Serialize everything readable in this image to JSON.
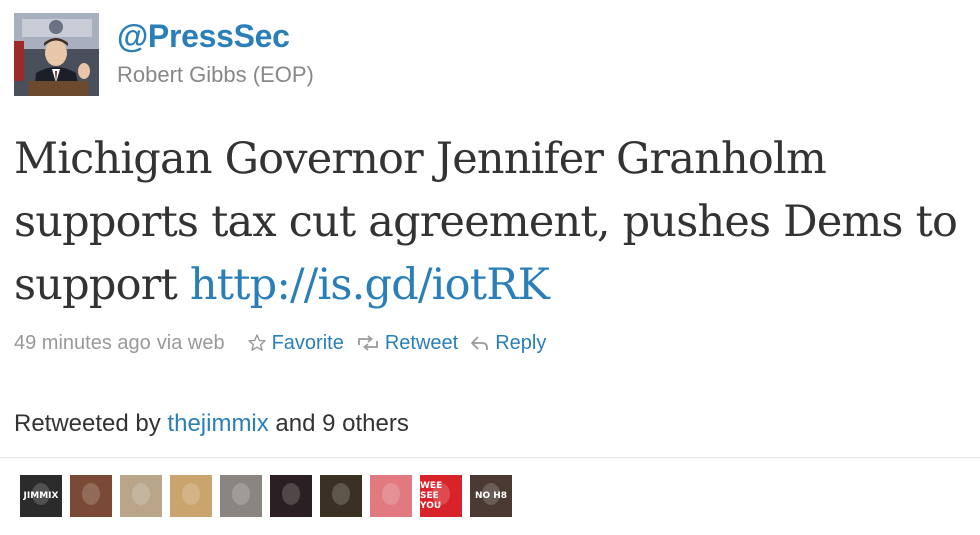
{
  "profile": {
    "handle": "@PressSec",
    "name": "Robert Gibbs (EOP)",
    "avatar_icon": "press-briefing-photo"
  },
  "tweet": {
    "text_before_link": "Michigan Governor Jennifer Granholm supports tax cut agreement, pushes Dems to support ",
    "link_text": "http://is.gd/iotRK"
  },
  "meta": {
    "timestamp": "49 minutes ago",
    "source": "via web",
    "actions": {
      "favorite": "Favorite",
      "retweet": "Retweet",
      "reply": "Reply"
    }
  },
  "retweeted_by": {
    "prefix": "Retweeted by ",
    "user": "thejimmix",
    "suffix": " and 9 others"
  },
  "retweeters": [
    {
      "name": "retweeter-1",
      "icon": "bw-text-avatar",
      "bg": "#2b2b2b",
      "text": "JIMMIX"
    },
    {
      "name": "retweeter-2",
      "icon": "woman-portrait",
      "bg": "#7a4a36",
      "text": ""
    },
    {
      "name": "retweeter-3",
      "icon": "beige-photo",
      "bg": "#b8a58a",
      "text": ""
    },
    {
      "name": "retweeter-4",
      "icon": "tan-photo",
      "bg": "#c9a46d",
      "text": ""
    },
    {
      "name": "retweeter-5",
      "icon": "gray-photo",
      "bg": "#8a8580",
      "text": ""
    },
    {
      "name": "retweeter-6",
      "icon": "dark-photo",
      "bg": "#2a1f22",
      "text": ""
    },
    {
      "name": "retweeter-7",
      "icon": "man-portrait",
      "bg": "#3b3024",
      "text": ""
    },
    {
      "name": "retweeter-8",
      "icon": "pink-photo",
      "bg": "#e07a80",
      "text": ""
    },
    {
      "name": "retweeter-9",
      "icon": "red-text-avatar",
      "bg": "#d8232a",
      "text": "WEE SEE YOU"
    },
    {
      "name": "retweeter-10",
      "icon": "noh8-portrait",
      "bg": "#4a3a33",
      "text": "NO H8"
    }
  ],
  "colors": {
    "link": "#2a7fb8",
    "muted": "#999999",
    "text": "#333333"
  }
}
